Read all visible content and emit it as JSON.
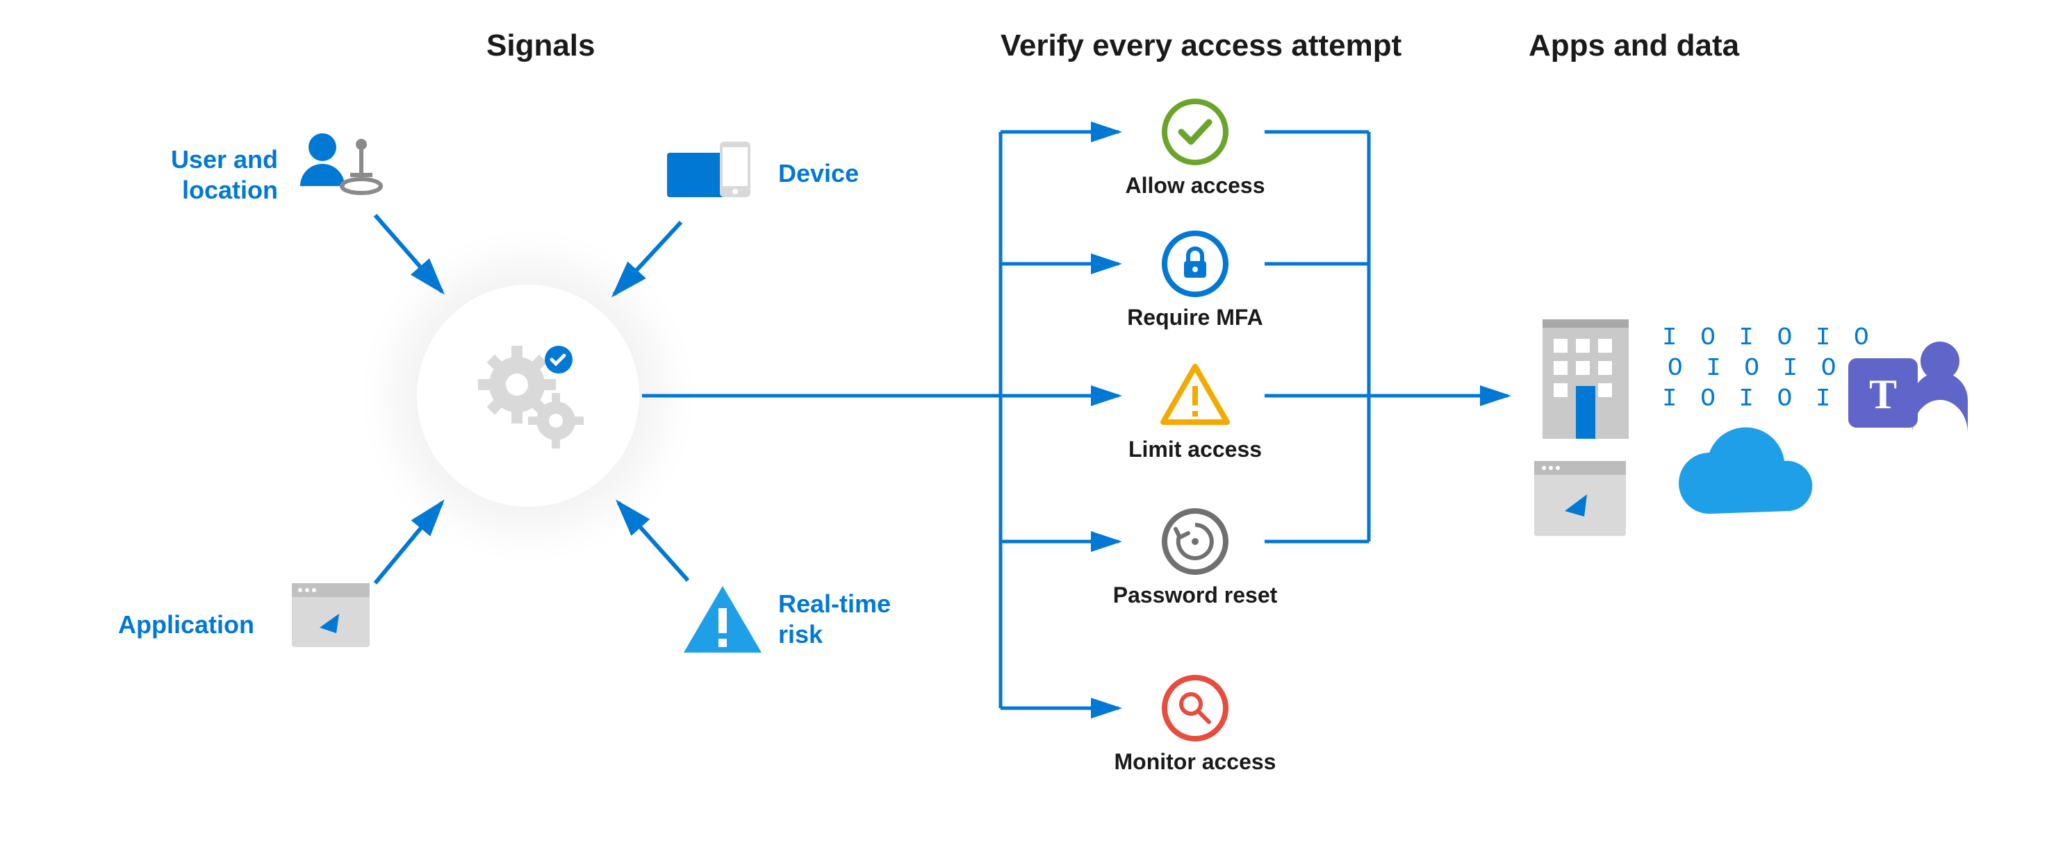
{
  "sections": {
    "signals": "Signals",
    "verify": "Verify every access attempt",
    "apps": "Apps and data"
  },
  "signals": {
    "user_location": "User and\nlocation",
    "device": "Device",
    "application": "Application",
    "realtime_risk": "Real-time\nrisk"
  },
  "verify": {
    "allow": "Allow access",
    "mfa": "Require MFA",
    "limit": "Limit access",
    "reset": "Password reset",
    "monitor": "Monitor access"
  },
  "colors": {
    "blue": "#0078d4",
    "green": "#6aa52a",
    "orange": "#f2a900",
    "red": "#e74c3c",
    "gray": "#707070",
    "teams": "#6065c9"
  }
}
